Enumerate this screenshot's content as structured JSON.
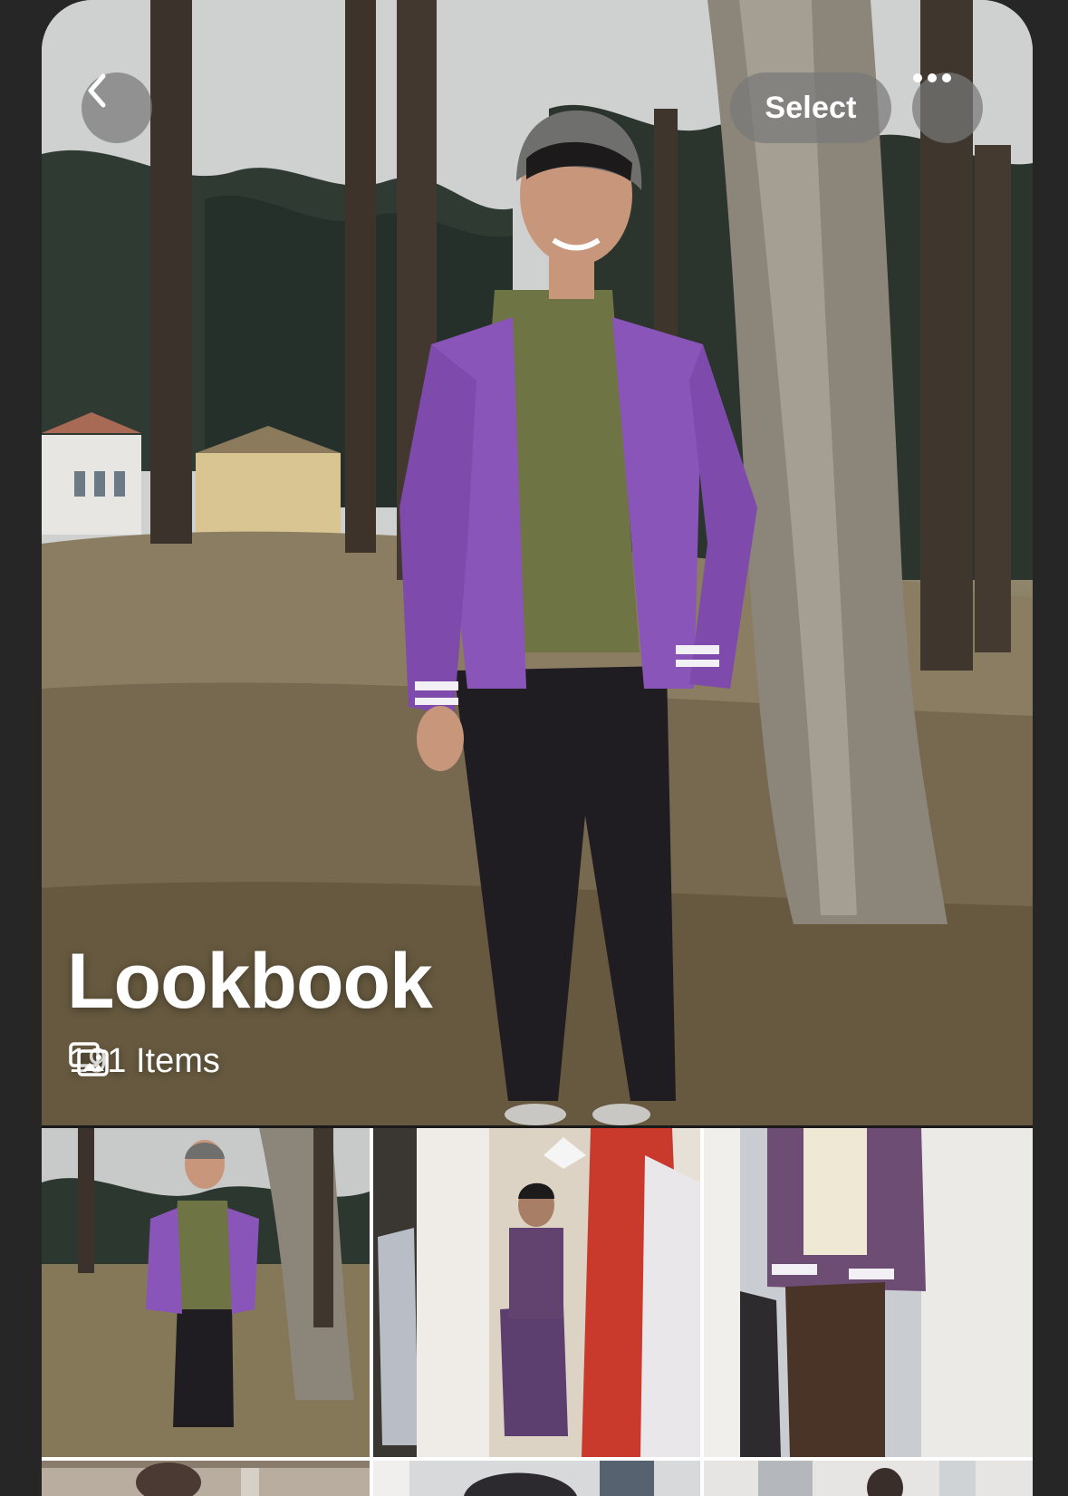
{
  "header": {
    "back_icon": "chevron-left-icon",
    "select_label": "Select",
    "more_icon": "ellipsis-icon"
  },
  "album": {
    "title": "Lookbook",
    "count_icon": "photo-stack-icon",
    "item_count": "191 Items"
  },
  "grid": {
    "thumbnails": [
      {
        "subject": "outdoor full-body photo, purple jacket"
      },
      {
        "subject": "mirror selfie, purple jacket"
      },
      {
        "subject": "mirror selfie, purple corduroy jacket"
      },
      {
        "subject": "photo"
      },
      {
        "subject": "photo"
      },
      {
        "subject": "photo"
      }
    ]
  },
  "colors": {
    "accent_purple": "#8a55b8",
    "hoodie_olive": "#6f7444",
    "button_fill": "#787878"
  }
}
